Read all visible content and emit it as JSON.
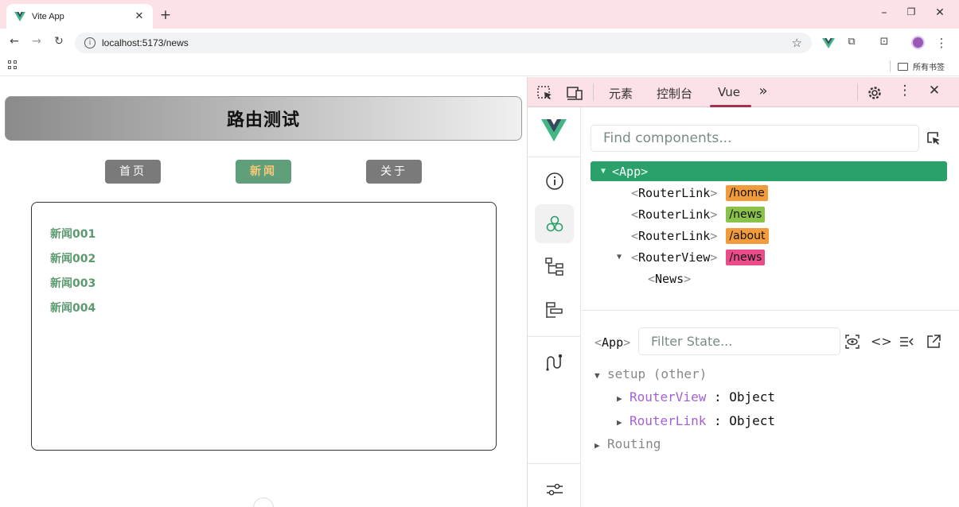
{
  "browser": {
    "tab_title": "Vite App",
    "url": "localhost:5173/news",
    "bookmarks_folder": "所有书签"
  },
  "page": {
    "title": "路由测试",
    "nav": [
      {
        "label": "首页",
        "active": false
      },
      {
        "label": "新闻",
        "active": true
      },
      {
        "label": "关于",
        "active": false
      }
    ],
    "news": [
      "新闻001",
      "新闻002",
      "新闻003",
      "新闻004"
    ]
  },
  "devtools": {
    "tabs": [
      "元素",
      "控制台",
      "Vue"
    ],
    "active_tab": "Vue",
    "vue": {
      "find_placeholder": "Find components...",
      "tree": [
        {
          "name": "App",
          "tag": "",
          "depth": 0,
          "expanded": true,
          "selected": true
        },
        {
          "name": "RouterLink",
          "tag": "/home",
          "tag_color": "#f29b3b",
          "depth": 1
        },
        {
          "name": "RouterLink",
          "tag": "/news",
          "tag_color": "#8bc24a",
          "depth": 1
        },
        {
          "name": "RouterLink",
          "tag": "/about",
          "tag_color": "#f29b3b",
          "depth": 1
        },
        {
          "name": "RouterView",
          "tag": "/news",
          "tag_color": "#ea4c89",
          "depth": 1,
          "expanded": true
        },
        {
          "name": "News",
          "tag": "",
          "depth": 2
        }
      ],
      "state_component": "App",
      "filter_placeholder": "Filter State...",
      "state": {
        "group_label": "setup (other)",
        "items": [
          {
            "key": "RouterView",
            "value": "Object"
          },
          {
            "key": "RouterLink",
            "value": "Object"
          }
        ],
        "routing_label": "Routing"
      }
    }
  },
  "colors": {
    "vue_green": "#2aa06a",
    "active_nav": "#5fa07a",
    "news_link": "#5a9a6e",
    "chrome_pink": "#fce1e7"
  }
}
